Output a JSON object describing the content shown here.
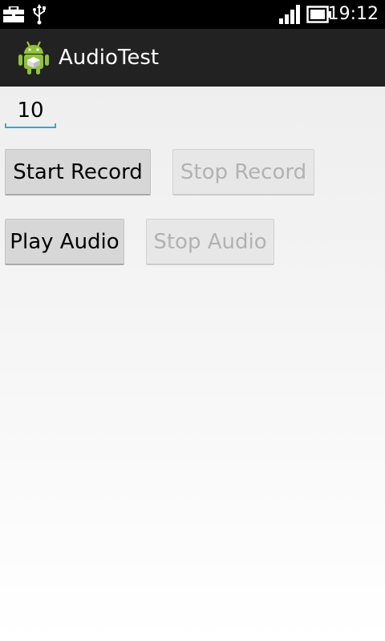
{
  "status_bar": {
    "time": "19:12",
    "icons": [
      "briefcase-icon",
      "usb-icon",
      "signal-icon",
      "battery-icon"
    ]
  },
  "action_bar": {
    "title": "AudioTest",
    "icon": "android-app-icon"
  },
  "main": {
    "number_field": {
      "value": "10"
    },
    "buttons": {
      "start_record": {
        "label": "Start Record",
        "enabled": true
      },
      "stop_record": {
        "label": "Stop Record",
        "enabled": false
      },
      "play_audio": {
        "label": "Play Audio",
        "enabled": true
      },
      "stop_audio": {
        "label": "Stop Audio",
        "enabled": false
      }
    }
  },
  "colors": {
    "status_bar_bg": "#000000",
    "action_bar_bg": "#222222",
    "field_underline": "#33a8d8",
    "button_enabled_bg": "#d7d7d7",
    "button_disabled_text": "#b2b2b2"
  }
}
